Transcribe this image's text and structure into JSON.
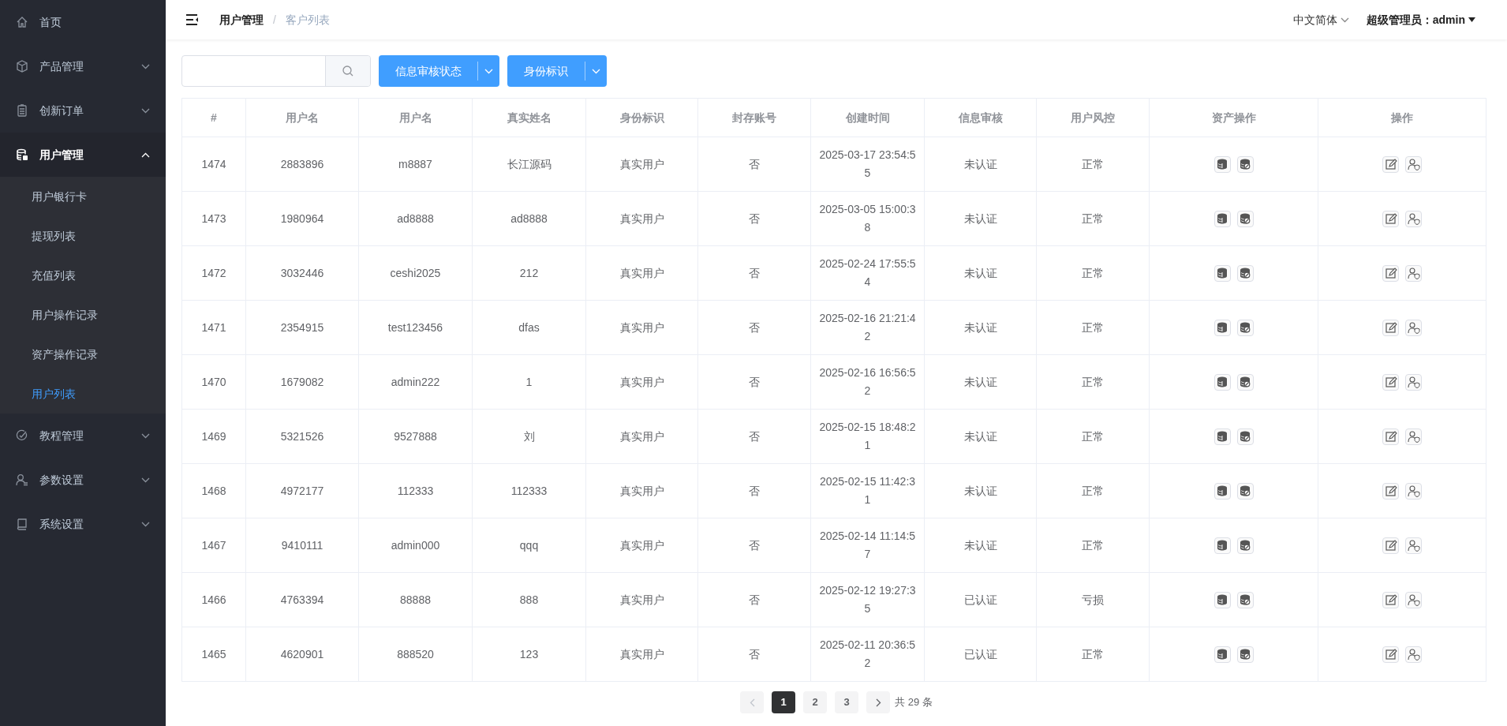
{
  "sidebar": {
    "items": [
      {
        "label": "首页",
        "kind": "home",
        "selected": false
      },
      {
        "label": "产品管理",
        "kind": "box",
        "selected": false,
        "expanded": false
      },
      {
        "label": "创新订单",
        "kind": "clipboard",
        "selected": false,
        "expanded": false
      },
      {
        "label": "用户管理",
        "kind": "database",
        "selected": true,
        "expanded": true,
        "children": [
          {
            "label": "用户银行卡",
            "selected": false
          },
          {
            "label": "提现列表",
            "selected": false
          },
          {
            "label": "充值列表",
            "selected": false
          },
          {
            "label": "用户操作记录",
            "selected": false
          },
          {
            "label": "资产操作记录",
            "selected": false
          },
          {
            "label": "用户列表",
            "selected": true
          }
        ]
      },
      {
        "label": "教程管理",
        "kind": "check",
        "selected": false,
        "expanded": false
      },
      {
        "label": "参数设置",
        "kind": "user",
        "selected": false,
        "expanded": false
      },
      {
        "label": "系统设置",
        "kind": "book",
        "selected": false,
        "expanded": false
      }
    ]
  },
  "header": {
    "breadcrumb": [
      "用户管理",
      "客户列表"
    ],
    "breadcrumb_separator": "/",
    "language": "中文简体",
    "user": "超级管理员：admin"
  },
  "toolbar": {
    "filters": [
      "信息审核状态",
      "身份标识"
    ]
  },
  "table": {
    "columns": [
      "#",
      "用户名",
      "用户名",
      "真实姓名",
      "身份标识",
      "封存账号",
      "创建时间",
      "信息审核",
      "用户风控",
      "资产操作",
      "操作"
    ],
    "rows": [
      [
        "1474",
        "2883896",
        "m8887",
        "长江源码",
        "真实用户",
        "否",
        "2025-03-17 23:54:55",
        "未认证",
        "正常"
      ],
      [
        "1473",
        "1980964",
        "ad8888",
        "ad8888",
        "真实用户",
        "否",
        "2025-03-05 15:00:38",
        "未认证",
        "正常"
      ],
      [
        "1472",
        "3032446",
        "ceshi2025",
        "212",
        "真实用户",
        "否",
        "2025-02-24 17:55:54",
        "未认证",
        "正常"
      ],
      [
        "1471",
        "2354915",
        "test123456",
        "dfas",
        "真实用户",
        "否",
        "2025-02-16 21:21:42",
        "未认证",
        "正常"
      ],
      [
        "1470",
        "1679082",
        "admin222",
        "1",
        "真实用户",
        "否",
        "2025-02-16 16:56:52",
        "未认证",
        "正常"
      ],
      [
        "1469",
        "5321526",
        "9527888",
        "刘",
        "真实用户",
        "否",
        "2025-02-15 18:48:21",
        "未认证",
        "正常"
      ],
      [
        "1468",
        "4972177",
        "112333",
        "112333",
        "真实用户",
        "否",
        "2025-02-15 11:42:31",
        "未认证",
        "正常"
      ],
      [
        "1467",
        "9410111",
        "admin000",
        "qqq",
        "真实用户",
        "否",
        "2025-02-14 11:14:57",
        "未认证",
        "正常"
      ],
      [
        "1466",
        "4763394",
        "88888",
        "888",
        "真实用户",
        "否",
        "2025-02-12 19:27:35",
        "已认证",
        "亏损"
      ],
      [
        "1465",
        "4620901",
        "888520",
        "123",
        "真实用户",
        "否",
        "2025-02-11 20:36:52",
        "已认证",
        "正常"
      ]
    ]
  },
  "pagination": {
    "pages": [
      {
        "label": "1",
        "selected": true
      },
      {
        "label": "2",
        "selected": false
      },
      {
        "label": "3",
        "selected": false
      }
    ],
    "total": "共 29 条"
  }
}
